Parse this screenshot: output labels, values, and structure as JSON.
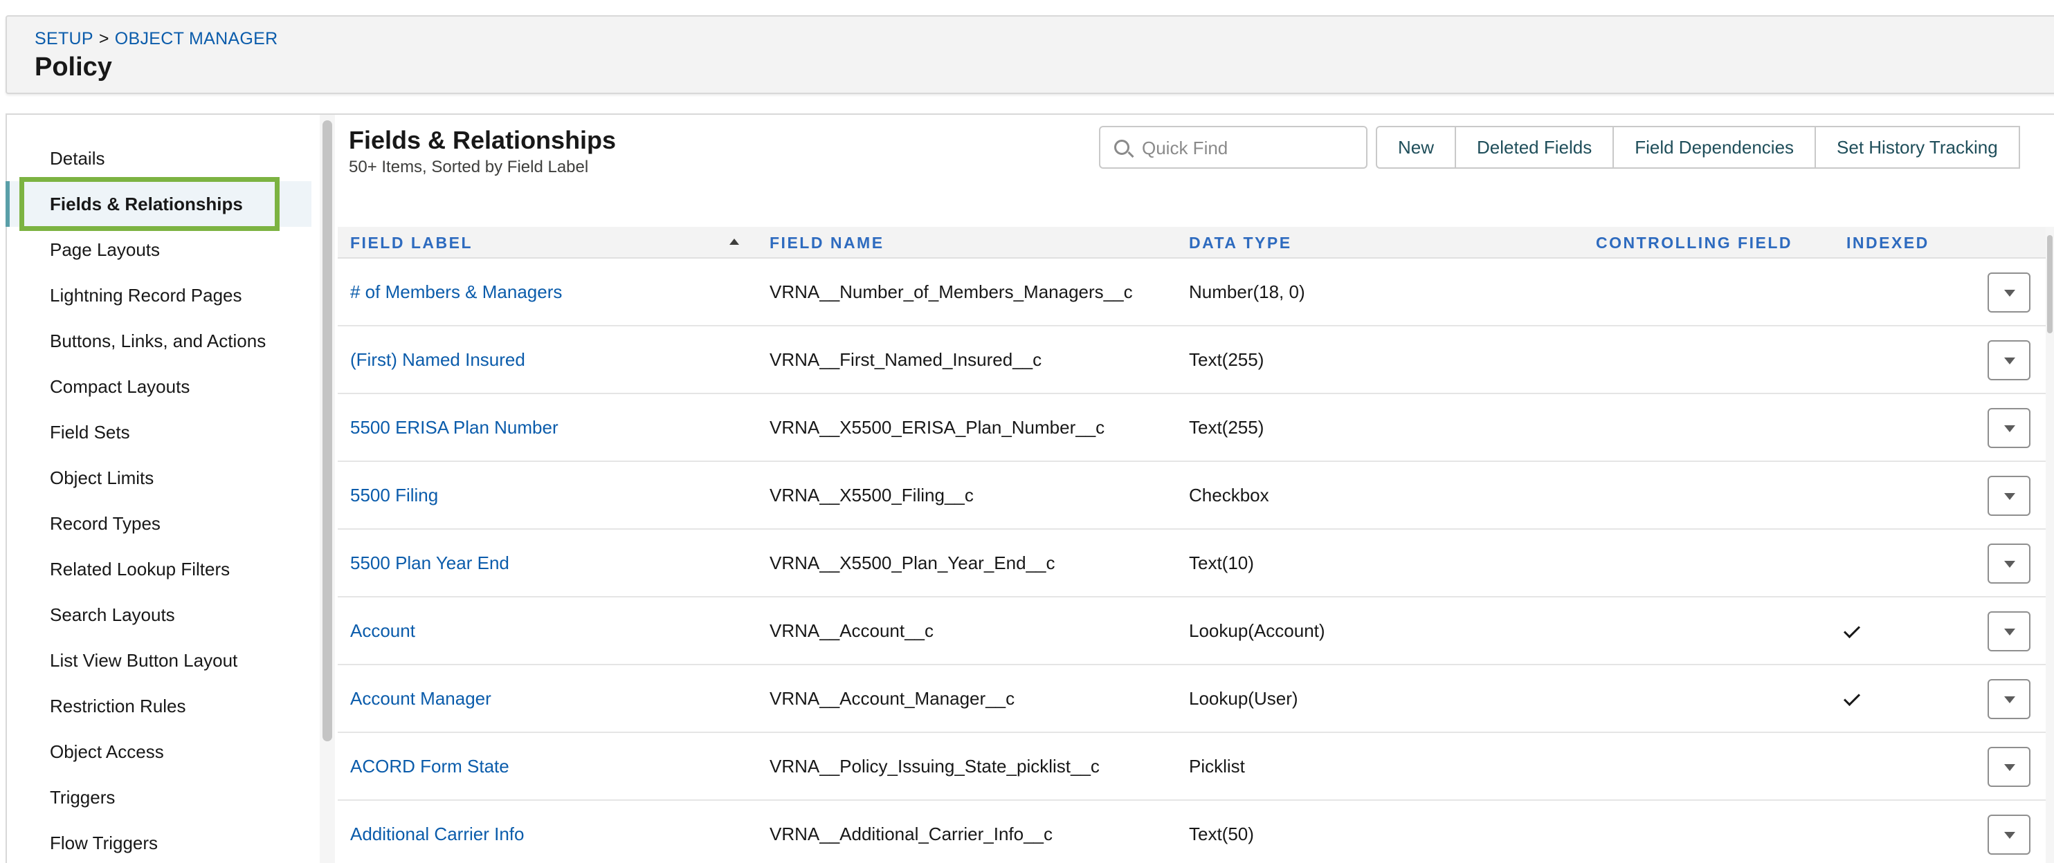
{
  "breadcrumb": {
    "setup": "SETUP",
    "separator": ">",
    "object_manager": "OBJECT MANAGER"
  },
  "page_title": "Policy",
  "sidebar": {
    "items": [
      {
        "label": "Details"
      },
      {
        "label": "Fields & Relationships",
        "active": true
      },
      {
        "label": "Page Layouts"
      },
      {
        "label": "Lightning Record Pages"
      },
      {
        "label": "Buttons, Links, and Actions"
      },
      {
        "label": "Compact Layouts"
      },
      {
        "label": "Field Sets"
      },
      {
        "label": "Object Limits"
      },
      {
        "label": "Record Types"
      },
      {
        "label": "Related Lookup Filters"
      },
      {
        "label": "Search Layouts"
      },
      {
        "label": "List View Button Layout"
      },
      {
        "label": "Restriction Rules"
      },
      {
        "label": "Object Access"
      },
      {
        "label": "Triggers"
      },
      {
        "label": "Flow Triggers"
      }
    ]
  },
  "main": {
    "title": "Fields & Relationships",
    "subtitle": "50+ Items, Sorted by Field Label",
    "quick_find_placeholder": "Quick Find",
    "buttons": {
      "new": "New",
      "deleted_fields": "Deleted Fields",
      "field_dependencies": "Field Dependencies",
      "set_history_tracking": "Set History Tracking"
    }
  },
  "table": {
    "columns": {
      "field_label": "FIELD LABEL",
      "field_name": "FIELD NAME",
      "data_type": "DATA TYPE",
      "controlling_field": "CONTROLLING FIELD",
      "indexed": "INDEXED"
    },
    "sorted_by": "FIELD LABEL",
    "sort_direction": "ascending",
    "rows": [
      {
        "label": "# of Members & Managers",
        "name": "VRNA__Number_of_Members_Managers__c",
        "type": "Number(18, 0)",
        "controlling": "",
        "indexed": false
      },
      {
        "label": "(First) Named Insured",
        "name": "VRNA__First_Named_Insured__c",
        "type": "Text(255)",
        "controlling": "",
        "indexed": false
      },
      {
        "label": "5500 ERISA Plan Number",
        "name": "VRNA__X5500_ERISA_Plan_Number__c",
        "type": "Text(255)",
        "controlling": "",
        "indexed": false
      },
      {
        "label": "5500 Filing",
        "name": "VRNA__X5500_Filing__c",
        "type": "Checkbox",
        "controlling": "",
        "indexed": false
      },
      {
        "label": "5500 Plan Year End",
        "name": "VRNA__X5500_Plan_Year_End__c",
        "type": "Text(10)",
        "controlling": "",
        "indexed": false
      },
      {
        "label": "Account",
        "name": "VRNA__Account__c",
        "type": "Lookup(Account)",
        "controlling": "",
        "indexed": true
      },
      {
        "label": "Account Manager",
        "name": "VRNA__Account_Manager__c",
        "type": "Lookup(User)",
        "controlling": "",
        "indexed": true
      },
      {
        "label": "ACORD Form State",
        "name": "VRNA__Policy_Issuing_State_picklist__c",
        "type": "Picklist",
        "controlling": "",
        "indexed": false
      },
      {
        "label": "Additional Carrier Info",
        "name": "VRNA__Additional_Carrier_Info__c",
        "type": "Text(50)",
        "controlling": "",
        "indexed": false
      }
    ]
  },
  "colors": {
    "link": "#0b5cab",
    "column_header": "#2e6bbf",
    "highlight": "#7cb342",
    "active_indicator": "#5a9fa8"
  }
}
